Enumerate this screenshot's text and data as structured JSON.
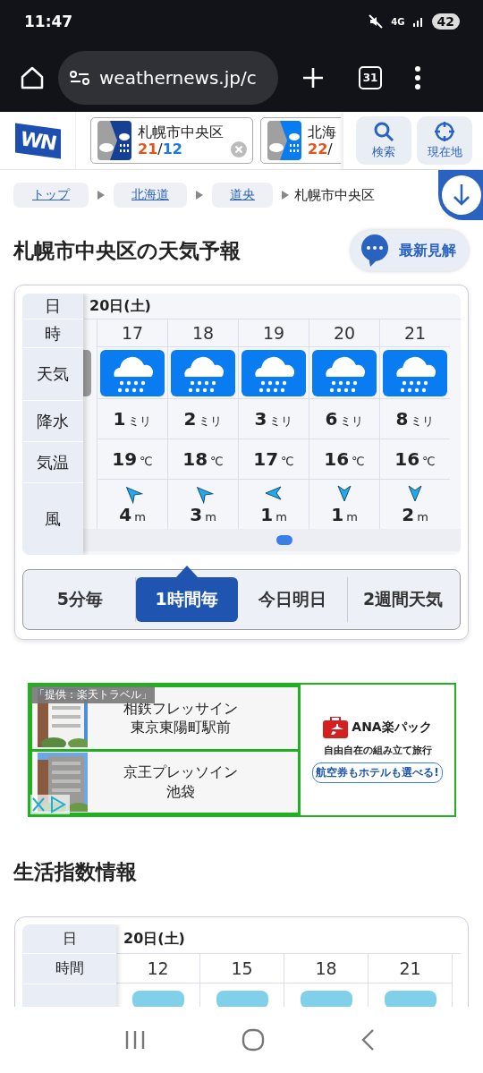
{
  "status_bar": {
    "time": "11:47",
    "network": "4G",
    "battery": "42"
  },
  "browser": {
    "url": "weathernews.jp/c",
    "tab_count": "31"
  },
  "header": {
    "logo": "WN",
    "locations": [
      {
        "name": "札幌市中央区",
        "high": "21",
        "separator": "/",
        "low": "12",
        "kind": "rain-dark",
        "closable": true
      },
      {
        "name": "北海",
        "high": "22",
        "separator": "/",
        "kind": "rain",
        "closable": false
      }
    ],
    "actions": [
      {
        "label": "検索",
        "kind": "search"
      },
      {
        "label": "現在地",
        "kind": "locate"
      }
    ]
  },
  "breadcrumb": {
    "links": [
      "トップ",
      "北海道",
      "道央"
    ],
    "current": "札幌市中央区"
  },
  "title": "札幌市中央区の天気予報",
  "latest_button": "最新見解",
  "forecast": {
    "row_labels": [
      "日",
      "時",
      "天気",
      "降水",
      "気温",
      "風"
    ],
    "date": "20日(土)",
    "hours": [
      {
        "hour": "17",
        "kind": "rain",
        "precip": "1",
        "precip_unit": "ミリ",
        "temp": "19",
        "temp_unit": "℃",
        "wind": {
          "kind": "northwest",
          "speed": "4",
          "unit": "m"
        }
      },
      {
        "hour": "18",
        "kind": "rain",
        "precip": "2",
        "precip_unit": "ミリ",
        "temp": "18",
        "temp_unit": "℃",
        "wind": {
          "kind": "northwest",
          "speed": "3",
          "unit": "m"
        }
      },
      {
        "hour": "19",
        "kind": "rain",
        "precip": "3",
        "precip_unit": "ミリ",
        "temp": "17",
        "temp_unit": "℃",
        "wind": {
          "kind": "west",
          "speed": "1",
          "unit": "m"
        }
      },
      {
        "hour": "20",
        "kind": "rain",
        "precip": "6",
        "precip_unit": "ミリ",
        "temp": "16",
        "temp_unit": "℃",
        "wind": {
          "kind": "south",
          "speed": "1",
          "unit": "m"
        }
      },
      {
        "hour": "21",
        "kind": "rain",
        "precip": "8",
        "precip_unit": "ミリ",
        "temp": "16",
        "temp_unit": "℃",
        "wind": {
          "kind": "south",
          "speed": "2",
          "unit": "m"
        }
      }
    ],
    "tabs": [
      {
        "label": "5分毎",
        "selected": false
      },
      {
        "label": "1時間毎",
        "selected": true
      },
      {
        "label": "今日明日",
        "selected": false
      },
      {
        "label": "2週間天気",
        "selected": false
      }
    ]
  },
  "ad": {
    "credit": "「提供：楽天トラベル」",
    "hotels": [
      {
        "kind": "picture",
        "name_lines": [
          "相鉄フレッサイン",
          "東京東陽町駅前"
        ]
      },
      {
        "kind": "picture",
        "name_lines": [
          "京王プレッソイン",
          "池袋"
        ]
      }
    ],
    "brand": "ANA楽パック",
    "tagline": "自由自在の組み立て旅行",
    "pill": "航空券もホテルも選べる!"
  },
  "life_index": {
    "title": "生活指数情報",
    "row_labels": [
      "日",
      "時間"
    ],
    "date": "20日(土)",
    "hours": [
      "12",
      "15",
      "18",
      "21"
    ]
  }
}
